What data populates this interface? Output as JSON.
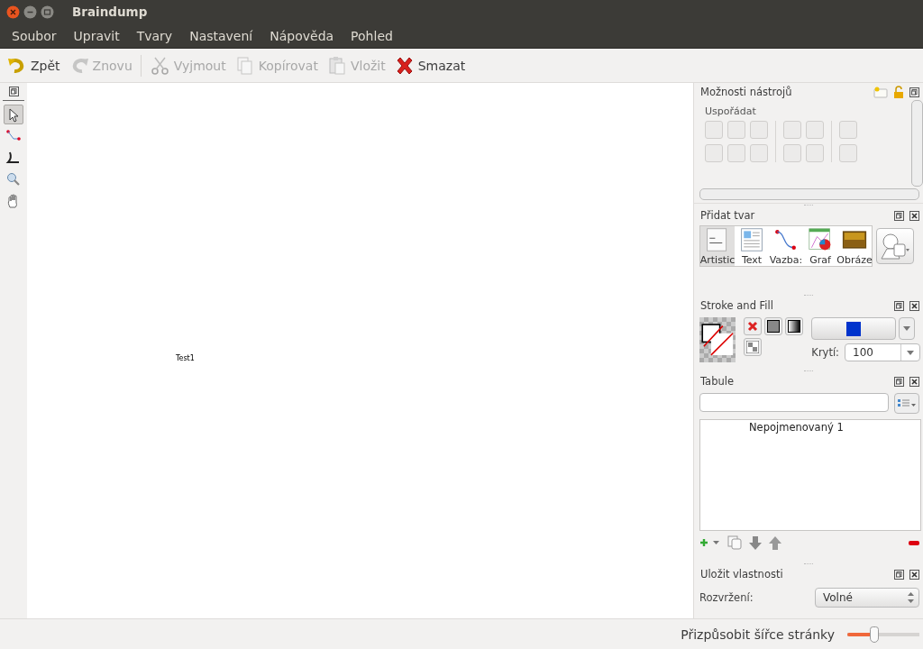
{
  "window": {
    "title": "Braindump"
  },
  "menu": [
    {
      "label": "Soubor"
    },
    {
      "label": "Upravit"
    },
    {
      "label": "Tvary"
    },
    {
      "label": "Nastavení"
    },
    {
      "label": "Nápověda"
    },
    {
      "label": "Pohled"
    }
  ],
  "toolbar": [
    [
      {
        "kind": "undo",
        "label": "Zpět",
        "disabled": false
      },
      {
        "kind": "redo",
        "label": "Znovu",
        "disabled": true
      }
    ],
    [
      {
        "kind": "cut",
        "label": "Vyjmout",
        "disabled": true
      },
      {
        "kind": "copy",
        "label": "Kopírovat",
        "disabled": true
      },
      {
        "kind": "paste",
        "label": "Vložit",
        "disabled": true
      },
      {
        "kind": "delete",
        "label": "Smazat",
        "disabled": false
      }
    ]
  ],
  "toolbox": [
    {
      "kind": "select",
      "selected": true
    },
    {
      "kind": "connector",
      "selected": false
    },
    {
      "kind": "path",
      "selected": false
    },
    {
      "kind": "zoom",
      "selected": false
    },
    {
      "kind": "pan",
      "selected": false
    }
  ],
  "canvas": {
    "text": "Test1"
  },
  "tool_options": {
    "title": "Možnosti nástrojů",
    "section": "Uspořádat"
  },
  "add_shape": {
    "title": "Přidat tvar",
    "items": [
      {
        "kind": "artistic",
        "label": "Artistic",
        "selected": true
      },
      {
        "kind": "text",
        "label": "Text",
        "selected": false
      },
      {
        "kind": "connection",
        "label": "Vazba:",
        "selected": false
      },
      {
        "kind": "chart",
        "label": "Graf",
        "selected": false
      },
      {
        "kind": "image",
        "label": "Obráze",
        "selected": false
      }
    ]
  },
  "stroke_fill": {
    "title": "Stroke and Fill",
    "fill": {
      "color": "#0033cc"
    },
    "opacity_label": "Krytí:",
    "opacity_value": "100"
  },
  "layers": {
    "title": "Tabule",
    "items": [
      {
        "label": "Nepojmenovaný 1"
      }
    ]
  },
  "save_properties": {
    "title": "Uložit vlastnosti",
    "layout_label": "Rozvržení:",
    "layout_value": "Volné"
  },
  "status_bar": {
    "zoom_label": "Přizpůsobit šířce stránky",
    "zoom": {
      "level": 0.35
    }
  }
}
